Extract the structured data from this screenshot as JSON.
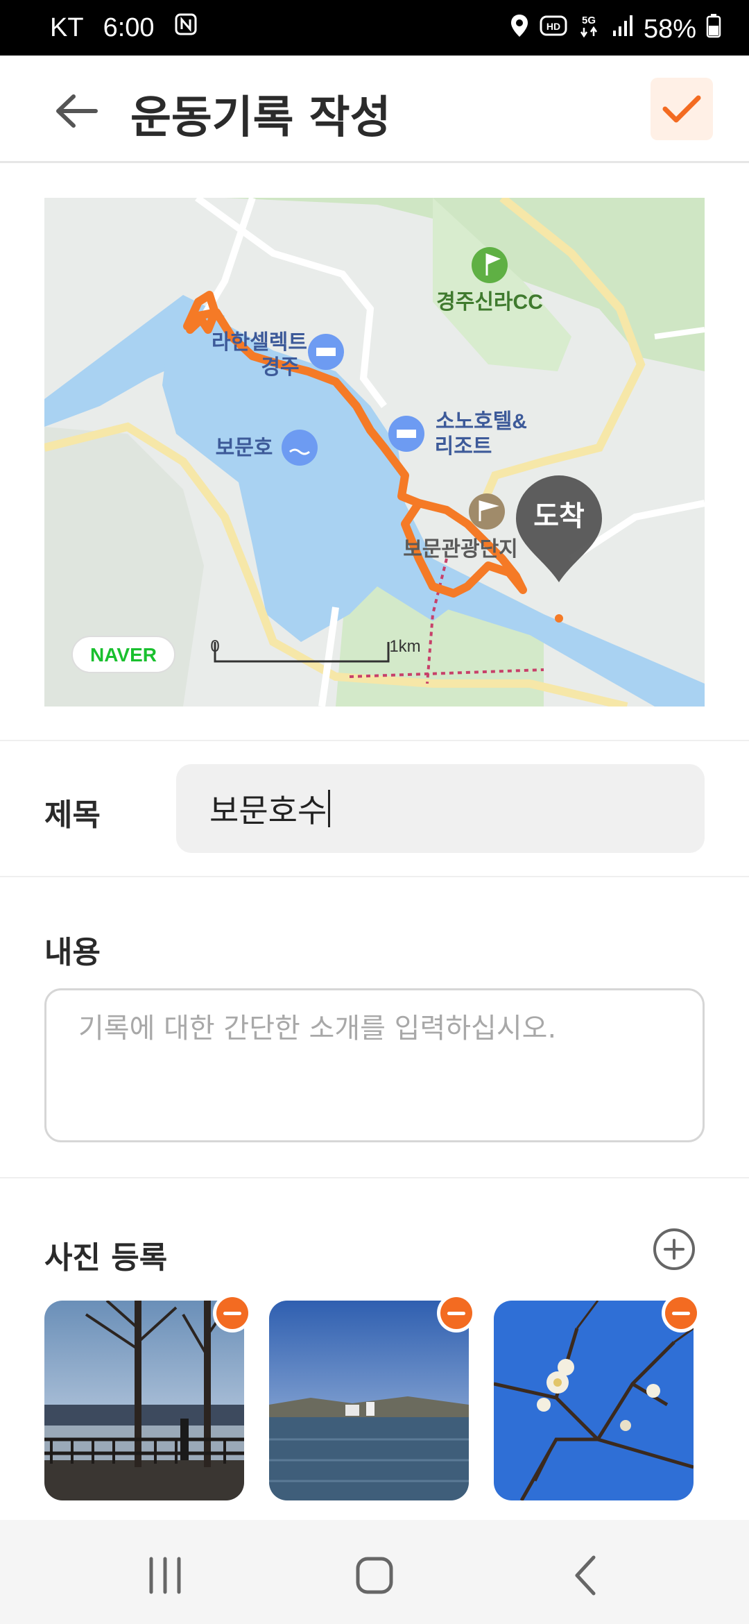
{
  "status_bar": {
    "carrier": "KT",
    "time": "6:00",
    "battery": "58%",
    "icons": [
      "nfc-icon",
      "location-icon",
      "hd-icon",
      "5g-icon",
      "signal-icon",
      "battery-icon"
    ]
  },
  "header": {
    "title": "운동기록 작성",
    "back_icon": "back-arrow-icon",
    "confirm_icon": "check-icon"
  },
  "map": {
    "labels": {
      "golf": "경주신라CC",
      "hotel1_line1": "라한셀렉트",
      "hotel1_line2": "경주",
      "lake": "보문호",
      "hotel2_line1": "소노호텔&",
      "hotel2_line2": "리조트",
      "tourist": "보문관광단지"
    },
    "arrival_marker": "도착",
    "logo": "NAVER",
    "scale_start": "0",
    "scale_end": "1km",
    "colors": {
      "route": "#f57a26",
      "water": "#a9d2f2",
      "park": "#cfe6c4"
    }
  },
  "form": {
    "title_label": "제목",
    "title_value": "보문호수",
    "content_label": "내용",
    "content_placeholder": "기록에 대한 간단한 소개를 입력하십시오.",
    "photo_label": "사진 등록",
    "add_photo_icon": "plus-circle-icon",
    "photos": [
      {
        "name": "photo-lakeside-trees",
        "remove_icon": "minus-circle-icon"
      },
      {
        "name": "photo-lake-view",
        "remove_icon": "minus-circle-icon"
      },
      {
        "name": "photo-plum-blossom",
        "remove_icon": "minus-circle-icon"
      }
    ]
  },
  "accent_color": "#f36b21",
  "nav_bar": {
    "icons": [
      "recent-apps-icon",
      "home-icon",
      "back-icon"
    ]
  }
}
